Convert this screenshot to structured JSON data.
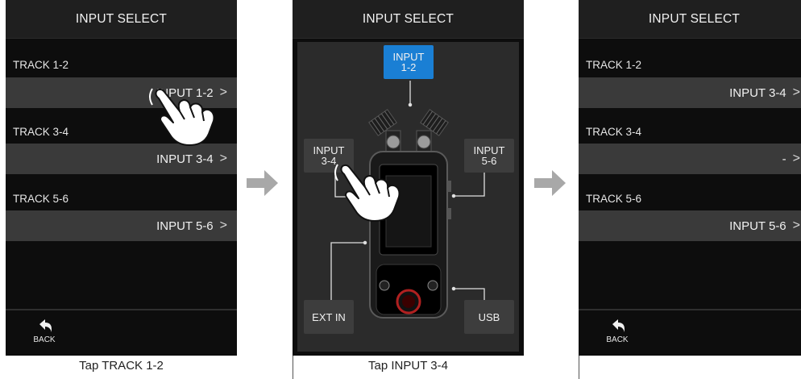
{
  "screens": [
    {
      "header": "INPUT SELECT",
      "tracks": [
        {
          "label": "TRACK 1-2",
          "value": "INPUT 1-2",
          "chevron": ">"
        },
        {
          "label": "TRACK 3-4",
          "value": "INPUT 3-4",
          "chevron": ">"
        },
        {
          "label": "TRACK 5-6",
          "value": "INPUT 5-6",
          "chevron": ">"
        }
      ],
      "back_label": "BACK",
      "caption": "Tap TRACK 1-2"
    },
    {
      "header": "INPUT SELECT",
      "inputs": {
        "in12_l1": "INPUT",
        "in12_l2": "1-2",
        "in34_l1": "INPUT",
        "in34_l2": "3-4",
        "in56_l1": "INPUT",
        "in56_l2": "5-6",
        "extin": "EXT IN",
        "usb": "USB"
      },
      "caption": "Tap INPUT 3-4"
    },
    {
      "header": "INPUT SELECT",
      "tracks": [
        {
          "label": "TRACK 1-2",
          "value": "INPUT 3-4",
          "chevron": ">"
        },
        {
          "label": "TRACK 3-4",
          "value": "-",
          "chevron": ">"
        },
        {
          "label": "TRACK 5-6",
          "value": "INPUT 5-6",
          "chevron": ">"
        }
      ],
      "back_label": "BACK"
    }
  ],
  "colors": {
    "screen_bg": "#0d0d0d",
    "header_bg": "#1f1f1f",
    "row_bg": "#3a3a3a",
    "selected_input": "#1a7fd4",
    "arrow": "#a8a8a8"
  },
  "icons": [
    "back-arrow-icon",
    "hand-tap-icon",
    "right-arrow-icon",
    "recorder-device-icon"
  ]
}
